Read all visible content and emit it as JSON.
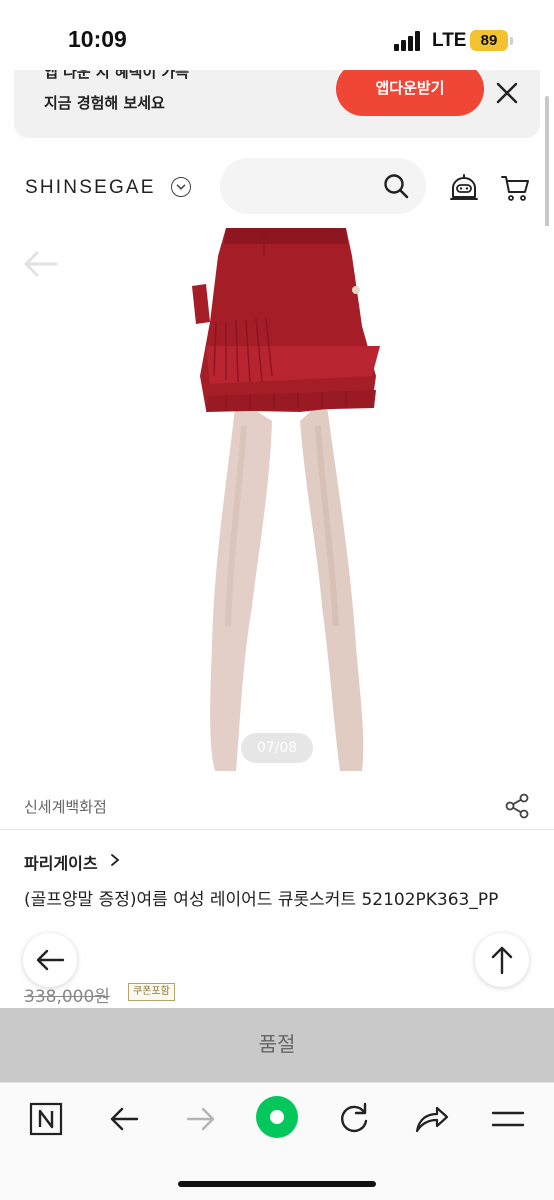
{
  "status_bar": {
    "time": "10:09",
    "network": "LTE",
    "battery": "89"
  },
  "app_banner": {
    "line1": "앱 다운 시 혜택이 가득",
    "line2": "지금 경험해 보세요",
    "download_label": "앱다운받기"
  },
  "header": {
    "logo": "SHINSEGAE"
  },
  "gallery": {
    "page_indicator": "07/08",
    "product_color": "#a51d27"
  },
  "seller": {
    "name": "신세계백화점"
  },
  "product": {
    "brand": "파리게이츠",
    "title": "(골프양말 증정)여름 여성 레이어드 큐롯스커트 52102PK363_PP",
    "original_price": "338,000원",
    "coupon_badge": "쿠폰포함"
  },
  "purchase_bar": {
    "label": "품절"
  },
  "browser_toolbar": {
    "items": [
      "naver-home-icon",
      "back-arrow-icon",
      "forward-arrow-icon",
      "green-dot-icon",
      "refresh-icon",
      "share-icon",
      "menu-icon"
    ],
    "accent": "#03c75a"
  },
  "colors": {
    "banner_button": "#ef4636",
    "soldout_bar": "#c9c9c9"
  }
}
